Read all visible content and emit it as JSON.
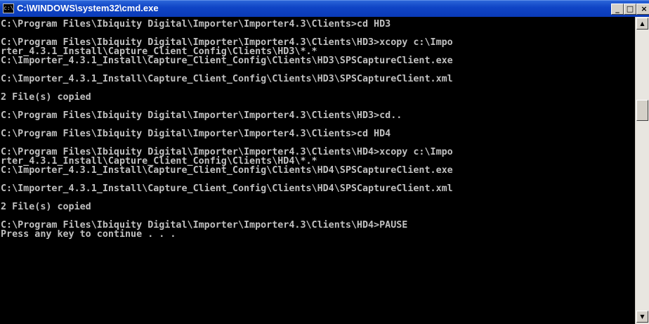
{
  "window": {
    "title": "C:\\WINDOWS\\system32\\cmd.exe",
    "icon_text": "c:\\"
  },
  "controls": {
    "minimize": "_",
    "maximize": "□",
    "close": "×"
  },
  "scrollbar": {
    "up_arrow": "▲",
    "down_arrow": "▼"
  },
  "console": {
    "lines": [
      "C:\\Program Files\\Ibiquity Digital\\Importer\\Importer4.3\\Clients>cd HD3",
      "",
      "C:\\Program Files\\Ibiquity Digital\\Importer\\Importer4.3\\Clients\\HD3>xcopy c:\\Impo",
      "rter_4.3.1_Install\\Capture_Client_Config\\Clients\\HD3\\*.*",
      "C:\\Importer_4.3.1_Install\\Capture_Client_Config\\Clients\\HD3\\SPSCaptureClient.exe",
      "",
      "C:\\Importer_4.3.1_Install\\Capture_Client_Config\\Clients\\HD3\\SPSCaptureClient.xml",
      "",
      "2 File(s) copied",
      "",
      "C:\\Program Files\\Ibiquity Digital\\Importer\\Importer4.3\\Clients\\HD3>cd..",
      "",
      "C:\\Program Files\\Ibiquity Digital\\Importer\\Importer4.3\\Clients>cd HD4",
      "",
      "C:\\Program Files\\Ibiquity Digital\\Importer\\Importer4.3\\Clients\\HD4>xcopy c:\\Impo",
      "rter_4.3.1_Install\\Capture_Client_Config\\Clients\\HD4\\*.*",
      "C:\\Importer_4.3.1_Install\\Capture_Client_Config\\Clients\\HD4\\SPSCaptureClient.exe",
      "",
      "C:\\Importer_4.3.1_Install\\Capture_Client_Config\\Clients\\HD4\\SPSCaptureClient.xml",
      "",
      "2 File(s) copied",
      "",
      "C:\\Program Files\\Ibiquity Digital\\Importer\\Importer4.3\\Clients\\HD4>PAUSE",
      "Press any key to continue . . ."
    ]
  },
  "colors": {
    "titlebar": "#0a3ab8",
    "console_bg": "#000000",
    "console_fg": "#c0c0c0"
  }
}
